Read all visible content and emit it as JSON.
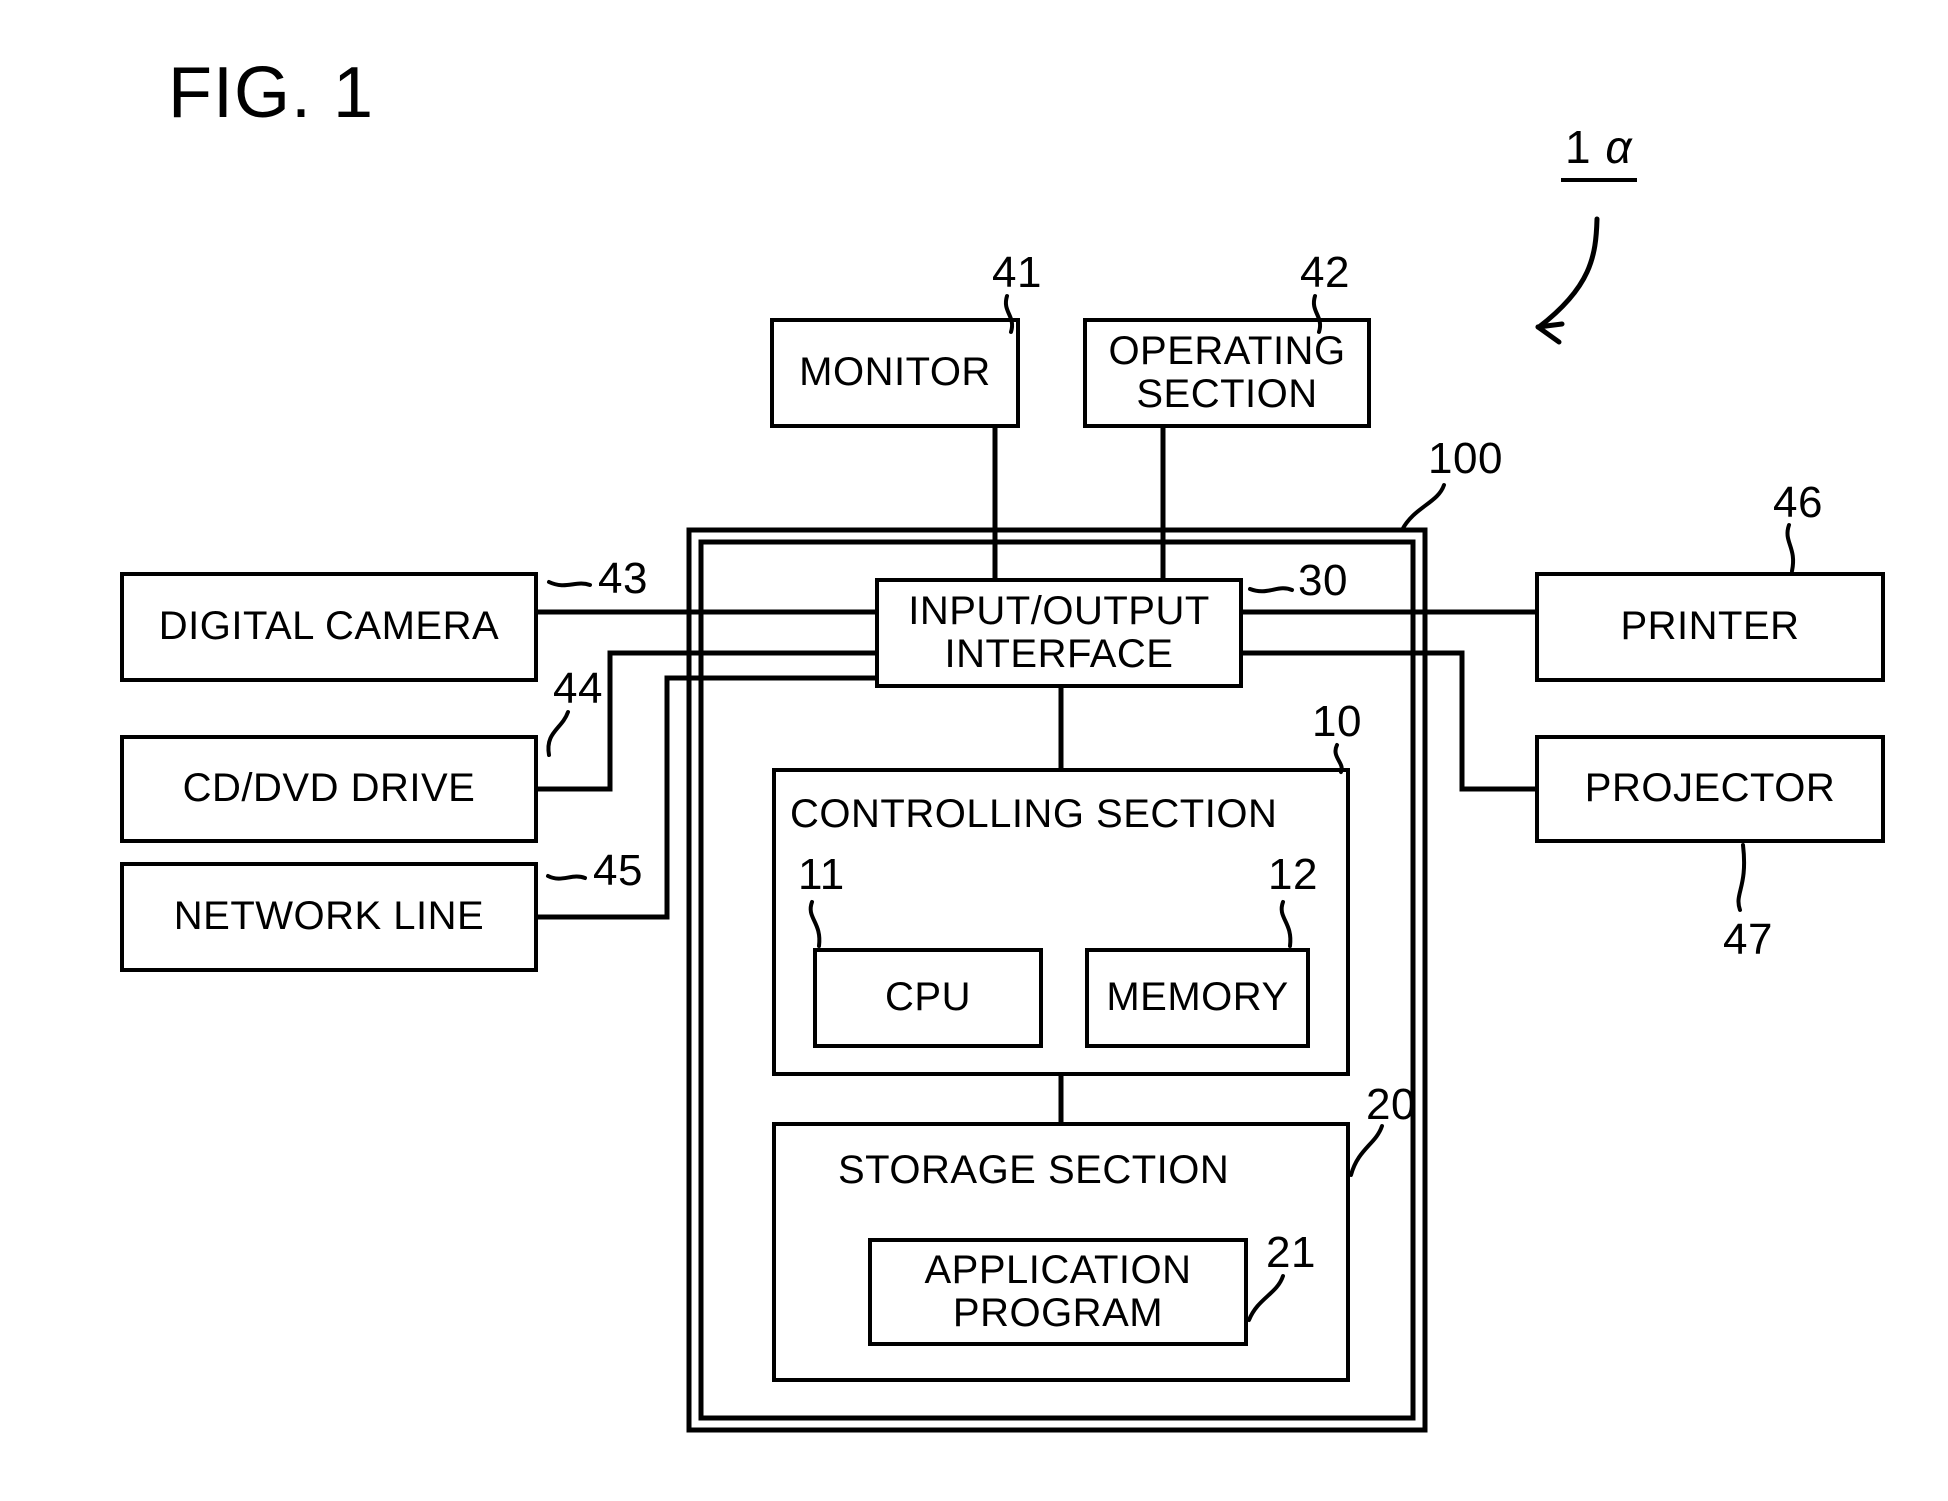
{
  "figure": {
    "title": "FIG. 1",
    "system_ref_number": "1",
    "system_ref_symbol": "α"
  },
  "blocks": [
    {
      "id": "monitor",
      "label": "MONITOR",
      "ref": "41"
    },
    {
      "id": "operating",
      "label": "OPERATING\nSECTION",
      "ref": "42"
    },
    {
      "id": "digital-camera",
      "label": "DIGITAL CAMERA",
      "ref": "43"
    },
    {
      "id": "cd-dvd-drive",
      "label": "CD/DVD DRIVE",
      "ref": "44"
    },
    {
      "id": "network-line",
      "label": "NETWORK LINE",
      "ref": "45"
    },
    {
      "id": "printer",
      "label": "PRINTER",
      "ref": "46"
    },
    {
      "id": "projector",
      "label": "PROJECTOR",
      "ref": "47"
    },
    {
      "id": "io-interface",
      "label": "INPUT/OUTPUT\nINTERFACE",
      "ref": "30"
    },
    {
      "id": "controlling",
      "label": "CONTROLLING SECTION",
      "ref": "10"
    },
    {
      "id": "cpu",
      "label": "CPU",
      "ref": "11"
    },
    {
      "id": "memory",
      "label": "MEMORY",
      "ref": "12"
    },
    {
      "id": "storage",
      "label": "STORAGE SECTION",
      "ref": "20"
    },
    {
      "id": "app-program",
      "label": "APPLICATION\nPROGRAM",
      "ref": "21"
    },
    {
      "id": "apparatus",
      "label": "",
      "ref": "100"
    }
  ],
  "refs": {
    "monitor": "41",
    "operating": "42",
    "digital_camera": "43",
    "cd_dvd_drive": "44",
    "network_line": "45",
    "printer": "46",
    "projector": "47",
    "io_interface": "30",
    "controlling": "10",
    "cpu": "11",
    "memory": "12",
    "storage": "20",
    "app_program": "21",
    "apparatus": "100"
  },
  "labels": {
    "monitor": "MONITOR",
    "operating": "OPERATING\nSECTION",
    "digital_camera": "DIGITAL CAMERA",
    "cd_dvd_drive": "CD/DVD DRIVE",
    "network_line": "NETWORK LINE",
    "printer": "PRINTER",
    "projector": "PROJECTOR",
    "io_interface": "INPUT/OUTPUT\nINTERFACE",
    "controlling": "CONTROLLING SECTION",
    "cpu": "CPU",
    "memory": "MEMORY",
    "storage": "STORAGE SECTION",
    "app_program": "APPLICATION\nPROGRAM"
  },
  "style": {
    "line_color": "#000000",
    "background": "#ffffff"
  }
}
